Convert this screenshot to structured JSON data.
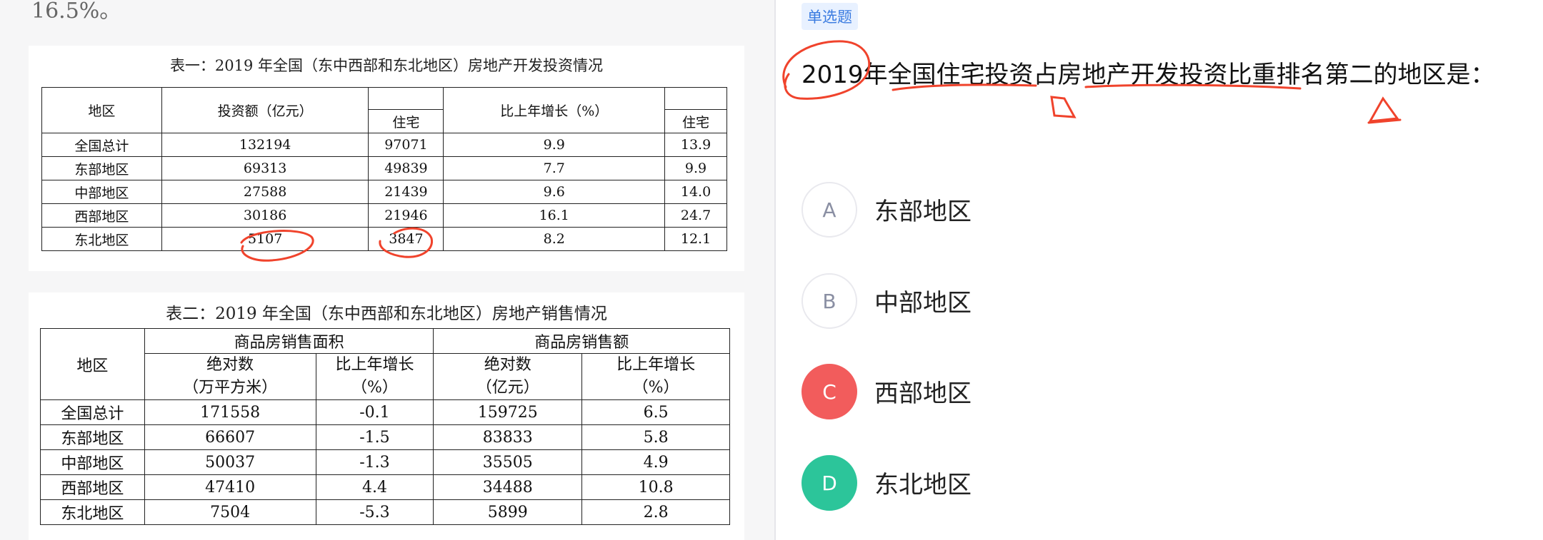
{
  "left": {
    "top_fragment": "16.5%。",
    "table1": {
      "title": "表一：2019 年全国（东中西部和东北地区）房地产开发投资情况",
      "headers": {
        "region": "地区",
        "investment": "投资额（亿元）",
        "residential": "住宅",
        "growth": "比上年增长（%）",
        "growth_residential": "住宅"
      },
      "rows": [
        [
          "全国总计",
          "132194",
          "97071",
          "9.9",
          "13.9"
        ],
        [
          "东部地区",
          "69313",
          "49839",
          "7.7",
          "9.9"
        ],
        [
          "中部地区",
          "27588",
          "21439",
          "9.6",
          "14.0"
        ],
        [
          "西部地区",
          "30186",
          "21946",
          "16.1",
          "24.7"
        ],
        [
          "东北地区",
          "5107",
          "3847",
          "8.2",
          "12.1"
        ]
      ]
    },
    "table2": {
      "title": "表二：2019 年全国（东中西部和东北地区）房地产销售情况",
      "headers": {
        "region": "地区",
        "area_group": "商品房销售面积",
        "amount_group": "商品房销售额",
        "area_abs_1": "绝对数",
        "area_abs_2": "（万平方米）",
        "area_growth_1": "比上年增长",
        "area_growth_2": "（%）",
        "amount_abs_1": "绝对数",
        "amount_abs_2": "（亿元）",
        "amount_growth_1": "比上年增长",
        "amount_growth_2": "（%）"
      },
      "rows": [
        [
          "全国总计",
          "171558",
          "-0.1",
          "159725",
          "6.5"
        ],
        [
          "东部地区",
          "66607",
          "-1.5",
          "83833",
          "5.8"
        ],
        [
          "中部地区",
          "50037",
          "-1.3",
          "35505",
          "4.9"
        ],
        [
          "西部地区",
          "47410",
          "4.4",
          "34488",
          "10.8"
        ],
        [
          "东北地区",
          "7504",
          "-5.3",
          "5899",
          "2.8"
        ]
      ]
    }
  },
  "right": {
    "tag": "单选题",
    "question": "2019年全国住宅投资占房地产开发投资比重排名第二的地区是：",
    "options": [
      {
        "letter": "A",
        "label": "东部地区",
        "state": "normal"
      },
      {
        "letter": "B",
        "label": "中部地区",
        "state": "normal"
      },
      {
        "letter": "C",
        "label": "西部地区",
        "state": "wrong"
      },
      {
        "letter": "D",
        "label": "东北地区",
        "state": "correct"
      }
    ]
  },
  "colors": {
    "annotation": "#f0432c",
    "wrong": "#f25c5c",
    "correct": "#2cc59a",
    "tag_bg": "#e8f1ff",
    "tag_text": "#3a7be0"
  }
}
